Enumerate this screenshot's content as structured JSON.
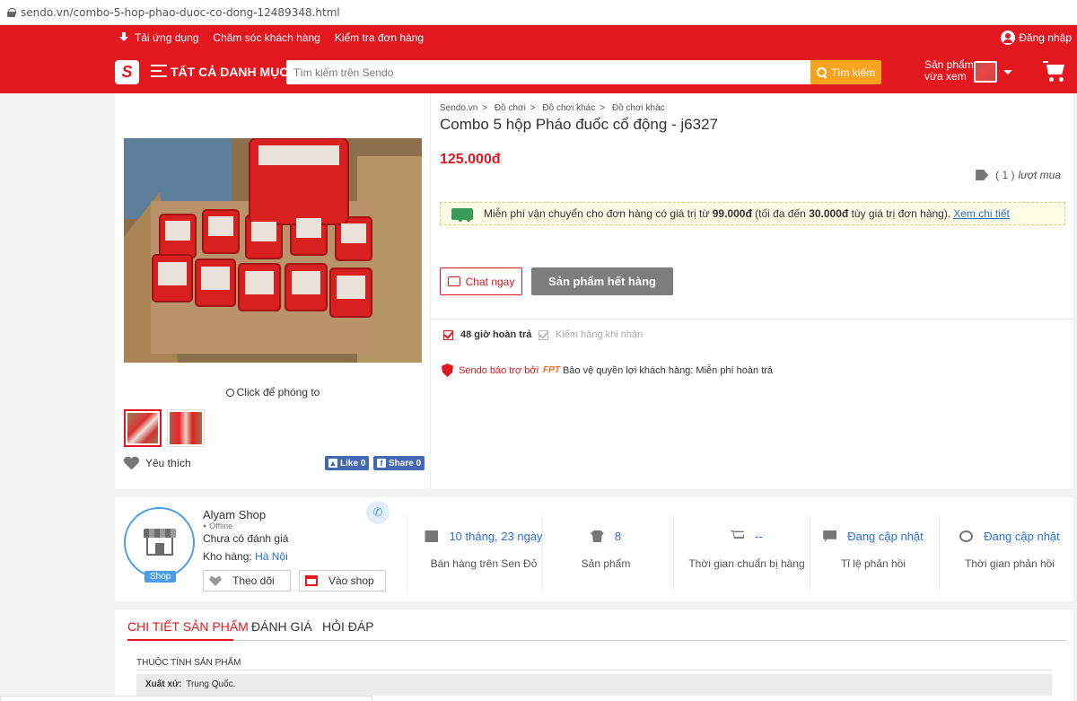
{
  "browser": {
    "url": "sendo.vn/combo-5-hop-phao-duoc-co-dong-12489348.html"
  },
  "topbar": {
    "download_app": "Tải ứng dụng",
    "customer_care": "Chăm sóc khách hàng",
    "track_order": "Kiểm tra đơn hàng",
    "login": "Đăng nhập"
  },
  "header": {
    "logo": "S",
    "all_categories": "TẤT CẢ DANH MỤC",
    "search_placeholder": "Tìm kiếm trên Sendo",
    "search_button": "Tìm kiếm",
    "recent_line1": "Sản phẩm",
    "recent_line2": "vừa xem"
  },
  "product": {
    "breadcrumb": [
      "Sendo.vn",
      "Đồ chơi",
      "Đồ chơi khác",
      "Đồ chơi khác"
    ],
    "title": "Combo 5 hộp Pháo đuốc cổ động - j6327",
    "price": "125.000đ",
    "purchase_count": "( 1 )",
    "purchase_label": "lượt mua",
    "shipping": {
      "text_before": "Miễn phí vận chuyển cho đơn hàng có giá trị từ",
      "min_value": "99.000đ",
      "text_middle": "(tối đa đến",
      "max_discount": "30.000đ",
      "text_after": "tùy giá trị đơn hàng).",
      "link": "Xem chi tiết"
    },
    "chat_button": "Chat ngay",
    "soldout_button": "Sản phẩm hết hàng",
    "policies": [
      "48 giờ hoàn trả",
      "Kiểm hàng khi nhận"
    ],
    "protection_label": "Sendo bảo trợ bởi",
    "protection_brand": "FPT",
    "protection_text": "Bảo vệ quyền lợi khách hàng: Miễn phí hoàn trả",
    "zoom_hint": "Click để phóng to",
    "favorite": "Yêu thích",
    "fb_like": "Like 0",
    "fb_share": "Share 0"
  },
  "shop": {
    "name": "Alyam Shop",
    "status": "Offline",
    "rating": "Chưa có đánh giá",
    "warehouse_label": "Kho hàng:",
    "warehouse_location": "Hà Nội",
    "badge": "Shop",
    "follow_button": "Theo dõi",
    "visit_button": "Vào shop",
    "stats": [
      {
        "value": "10 tháng, 23 ngày",
        "label": "Bán hàng trên Sen Đỏ"
      },
      {
        "value": "8",
        "label": "Sản phẩm"
      },
      {
        "value": "--",
        "label": "Thời gian chuẩn bị hàng"
      },
      {
        "value": "Đang cập nhật",
        "label": "Tỉ lệ phản hồi"
      },
      {
        "value": "Đang cập nhật",
        "label": "Thời gian phản hồi"
      }
    ]
  },
  "details": {
    "tabs": [
      "CHI TIẾT SẢN PHẨM",
      "ĐÁNH GIÁ",
      "HỎI ĐÁP"
    ],
    "attributes_title": "THUỘC TÍNH SẢN PHẨM",
    "origin_label": "Xuất xứ:",
    "origin_value": "Trung Quốc."
  },
  "colors": {
    "brand_red": "#e3171e",
    "search_orange": "#f8a31c",
    "link_blue": "#2a6fdb",
    "shop_blue": "#4b9de9"
  }
}
